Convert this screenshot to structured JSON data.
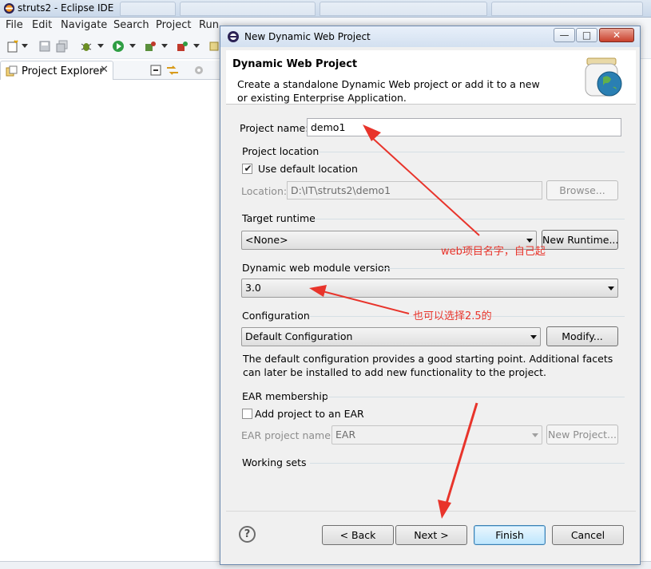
{
  "eclipse": {
    "window_title": "struts2 - Eclipse IDE",
    "menu": [
      "File",
      "Edit",
      "Navigate",
      "Search",
      "Project",
      "Run"
    ],
    "view_tab": "Project Explorer",
    "view_tab_close": "✕"
  },
  "dialog": {
    "title": "New Dynamic Web Project",
    "window_buttons": {
      "minimize": "—",
      "maximize": "□",
      "close": "✕"
    },
    "header_title": "Dynamic Web Project",
    "header_description": "Create a standalone Dynamic Web project or add it to a new or existing Enterprise Application.",
    "project_name_label": "Project name:",
    "project_name_value": "demo1",
    "project_location": {
      "group_title": "Project location",
      "use_default_label": "Use default location",
      "use_default_checked": true,
      "location_label": "Location:",
      "location_value": "D:\\IT\\struts2\\demo1",
      "browse_button": "Browse..."
    },
    "target_runtime": {
      "group_title": "Target runtime",
      "selected": "<None>",
      "new_runtime_button": "New Runtime..."
    },
    "module_version": {
      "group_title": "Dynamic web module version",
      "selected": "3.0"
    },
    "configuration": {
      "group_title": "Configuration",
      "selected": "Default Configuration",
      "modify_button": "Modify...",
      "description": "The default configuration provides a good starting point. Additional facets can later be installed to add new functionality to the project."
    },
    "ear_membership": {
      "group_title": "EAR membership",
      "add_to_ear_label": "Add project to an EAR",
      "add_to_ear_checked": false,
      "ear_project_name_label": "EAR project name:",
      "ear_project_name_value": "EAR",
      "new_project_button": "New Project..."
    },
    "working_sets_title": "Working sets",
    "buttons": {
      "help": "?",
      "back": "< Back",
      "next": "Next >",
      "finish": "Finish",
      "cancel": "Cancel"
    }
  },
  "annotations": {
    "project_name_note": "web项目名字，自己起",
    "version_note": "也可以选择2.5的"
  },
  "colors": {
    "annotation_red": "#e8342b",
    "dialog_border": "#6d8aaf",
    "default_button_border": "#3c7fb1"
  }
}
